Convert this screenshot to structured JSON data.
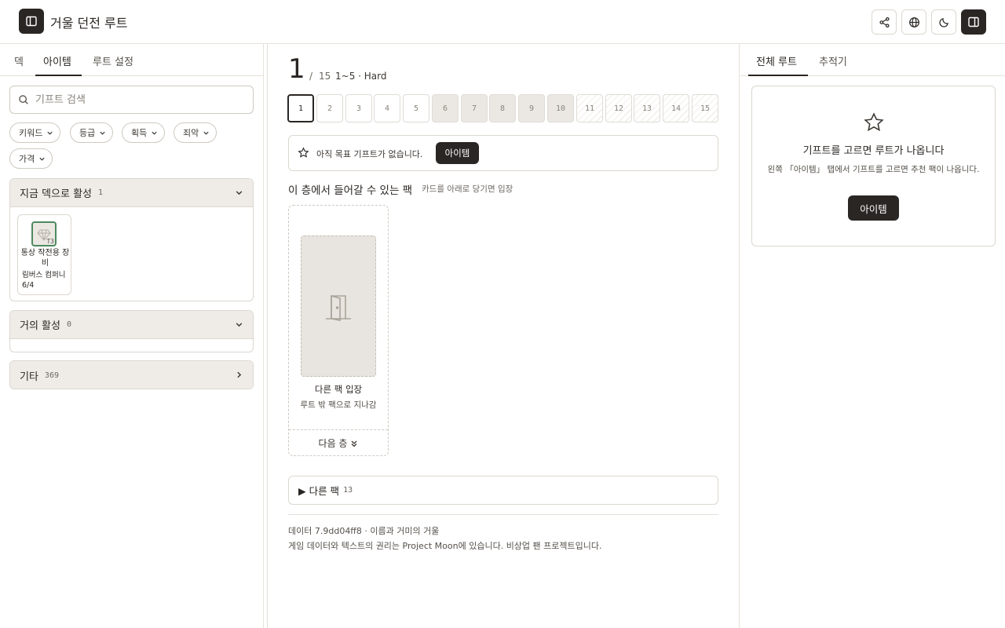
{
  "header": {
    "title": "거울 던전 루트",
    "icons": [
      "sidebar-left-icon",
      "share-icon",
      "globe-icon",
      "moon-icon",
      "sidebar-right-icon"
    ]
  },
  "left_panel": {
    "tabs": [
      {
        "label": "덱",
        "active": false
      },
      {
        "label": "아이템",
        "active": true
      },
      {
        "label": "루트 설정",
        "active": false
      }
    ],
    "search": {
      "placeholder": "기프트 검색",
      "value": ""
    },
    "filters": [
      "키워드",
      "등급",
      "획득",
      "죄악",
      "가격"
    ],
    "groups": [
      {
        "title": "지금 덱으로 활성",
        "count": "1",
        "expanded": true,
        "items": [
          {
            "name": "통상 작전용 장비",
            "sub": "림버스 컴퍼니 6/4",
            "tier": "T3"
          }
        ]
      },
      {
        "title": "거의 활성",
        "count": "0",
        "expanded": true,
        "items": []
      },
      {
        "title": "기타",
        "count": "369",
        "expanded": false,
        "items": []
      }
    ]
  },
  "center": {
    "floor": {
      "current": "1",
      "slash": "/",
      "total": "15",
      "meta": "1~5 · Hard"
    },
    "floors": [
      {
        "n": "1",
        "state": "current"
      },
      {
        "n": "2",
        "state": "open"
      },
      {
        "n": "3",
        "state": "open"
      },
      {
        "n": "4",
        "state": "open"
      },
      {
        "n": "5",
        "state": "open"
      },
      {
        "n": "6",
        "state": "shaded"
      },
      {
        "n": "7",
        "state": "shaded"
      },
      {
        "n": "8",
        "state": "shaded"
      },
      {
        "n": "9",
        "state": "shaded"
      },
      {
        "n": "10",
        "state": "shaded"
      },
      {
        "n": "11",
        "state": "hatched"
      },
      {
        "n": "12",
        "state": "hatched"
      },
      {
        "n": "13",
        "state": "hatched"
      },
      {
        "n": "14",
        "state": "hatched"
      },
      {
        "n": "15",
        "state": "hatched"
      }
    ],
    "goal": {
      "text": "아직 목표 기프트가 없습니다.",
      "button": "아이템"
    },
    "packs_section": {
      "title": "이 층에서 들어갈 수 있는 팩",
      "subtitle": "카드를 아래로 당기면 입장"
    },
    "pack_card": {
      "name": "다른 팩 입장",
      "desc": "루트 밖 팩으로 지나감",
      "next": "다음 층"
    },
    "other_packs": {
      "label": "▶ 다른 팩",
      "count": "13"
    },
    "footer": {
      "line1": "데이터 7.9dd04ff8 · 이름과 거미의 거울",
      "line2": "게임 데이터와 텍스트의 권리는 Project Moon에 있습니다. 비상업 팬 프로젝트입니다."
    }
  },
  "right_panel": {
    "tabs": [
      {
        "label": "전체 루트",
        "active": true
      },
      {
        "label": "추적기",
        "active": false
      }
    ],
    "empty": {
      "title": "기프트를 고르면 루트가 나옵니다",
      "desc": "왼쪽 「아이템」 탭에서 기프트를 고르면 추천 팩이 나옵니다.",
      "button": "아이템"
    }
  }
}
